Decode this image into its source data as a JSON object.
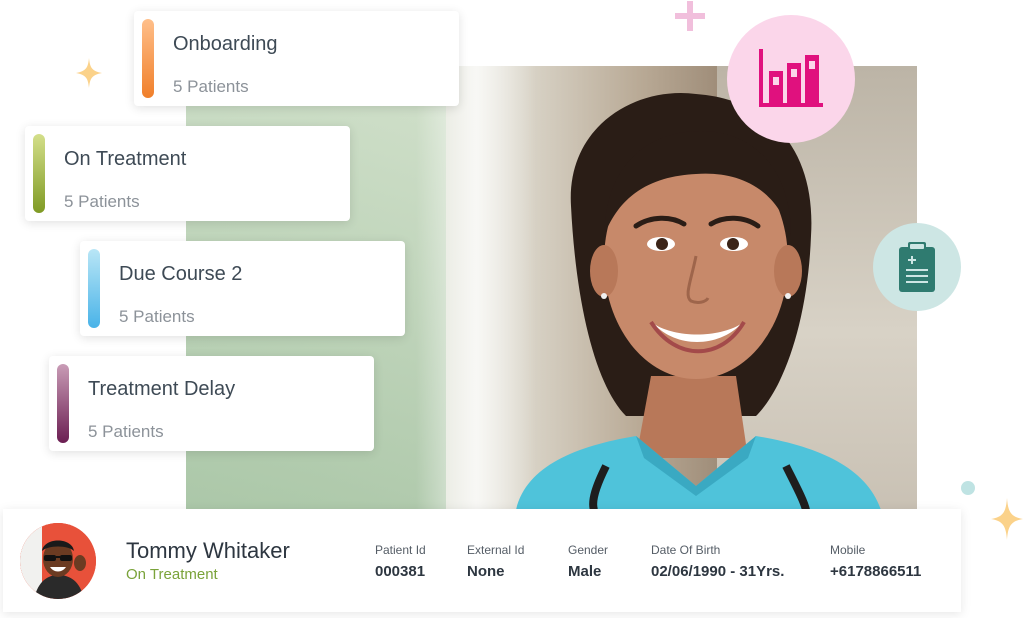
{
  "cards": [
    {
      "title": "Onboarding",
      "subtitle": "5 Patients",
      "color_top": "#ffbf8a",
      "color_bottom": "#f07f2a"
    },
    {
      "title": "On Treatment",
      "subtitle": "5 Patients",
      "color_top": "#d4df8a",
      "color_bottom": "#7f9a24"
    },
    {
      "title": "Due Course 2",
      "subtitle": "5 Patients",
      "color_top": "#b9e6f6",
      "color_bottom": "#49b3e8"
    },
    {
      "title": "Treatment Delay",
      "subtitle": "5 Patients",
      "color_top": "#c99cb6",
      "color_bottom": "#6b1e52"
    }
  ],
  "patient": {
    "name": "Tommy Whitaker",
    "status": "On Treatment",
    "fields": [
      {
        "label": "Patient Id",
        "value": "000381"
      },
      {
        "label": "External Id",
        "value": "None"
      },
      {
        "label": "Gender",
        "value": "Male"
      },
      {
        "label": "Date Of Birth",
        "value": "02/06/1990 - 31Yrs."
      },
      {
        "label": "Mobile",
        "value": "+6178866511"
      }
    ]
  },
  "icons": {
    "chart": "bar-chart-icon",
    "clipboard": "clipboard-icon"
  },
  "colors": {
    "chart_circle": "#fbd6ea",
    "chart_icon": "#e0117e",
    "clip_circle": "#cde6e4",
    "clip_icon": "#2f7b70",
    "status_green": "#7aa33a"
  }
}
